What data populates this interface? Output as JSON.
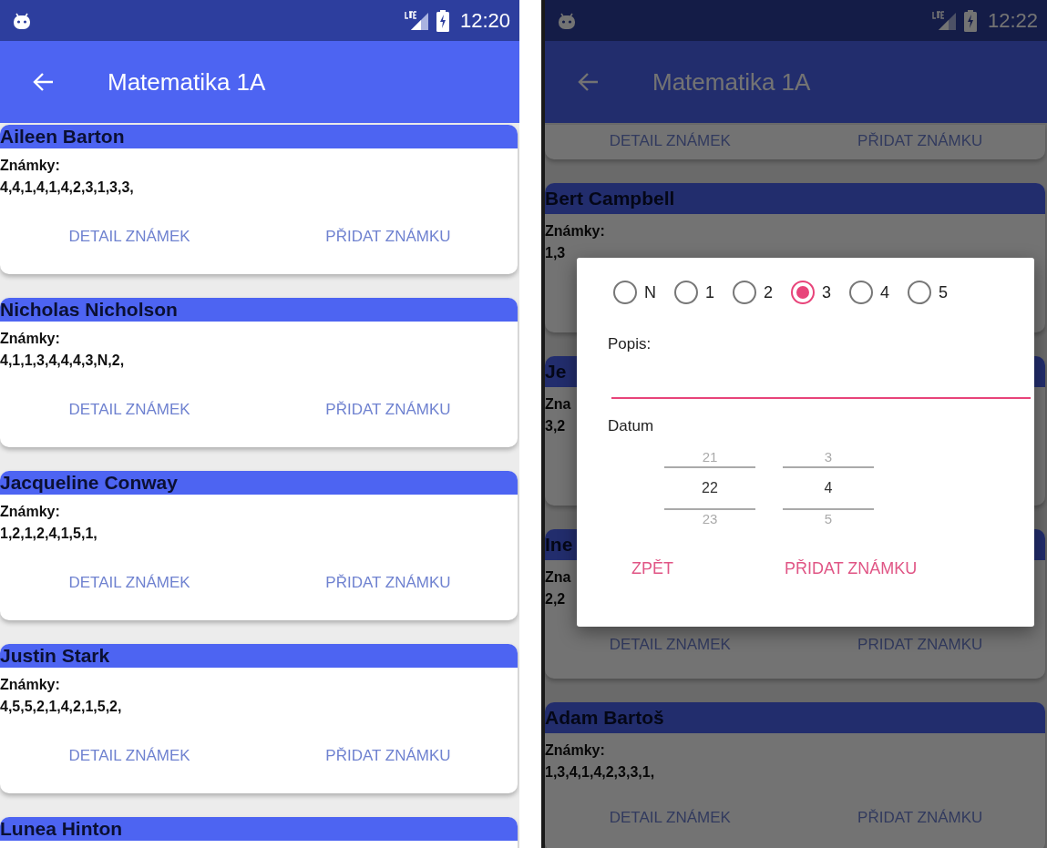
{
  "screens": [
    {
      "dimmed": false,
      "status_bar": {
        "time": "12:20"
      },
      "toolbar": {
        "title": "Matematika 1A"
      },
      "students": [
        {
          "kind": "full",
          "name": "Aileen Barton",
          "grades_label": "Známky:",
          "grades": "4,4,1,4,1,4,2,3,1,3,3,",
          "buttons": [
            "DETAIL ZNÁMEK",
            "PŘIDAT ZNÁMKU"
          ]
        },
        {
          "kind": "full",
          "name": "Nicholas Nicholson",
          "grades_label": "Známky:",
          "grades": "4,1,1,3,4,4,4,3,N,2,",
          "buttons": [
            "DETAIL ZNÁMEK",
            "PŘIDAT ZNÁMKU"
          ]
        },
        {
          "kind": "full",
          "name": "Jacqueline Conway",
          "grades_label": "Známky:",
          "grades": "1,2,1,2,4,1,5,1,",
          "buttons": [
            "DETAIL ZNÁMEK",
            "PŘIDAT ZNÁMKU"
          ]
        },
        {
          "kind": "full",
          "name": "Justin Stark",
          "grades_label": "Známky:",
          "grades": "4,5,5,2,1,4,2,1,5,2,",
          "buttons": [
            "DETAIL ZNÁMEK",
            "PŘIDAT ZNÁMKU"
          ]
        },
        {
          "kind": "full",
          "name": "Lunea Hinton"
        }
      ]
    },
    {
      "dimmed": true,
      "status_bar": {
        "time": "12:22"
      },
      "toolbar": {
        "title": "Matematika 1A"
      },
      "students": [
        {
          "kind": "partial",
          "buttons": [
            "DETAIL ZNÁMEK",
            "PŘIDAT ZNÁMKU"
          ]
        },
        {
          "kind": "full",
          "name": "Bert Campbell",
          "grades_label": "Známky:",
          "grades": "1,3"
        },
        {
          "kind": "full",
          "name": "Je",
          "grades_label": "Zna",
          "grades": "3,2"
        },
        {
          "kind": "full",
          "name": "Ine",
          "grades_label": "Zna",
          "grades": "2,2",
          "buttons": [
            "DETAIL ZNAMEK",
            "PRIDAT ZNAMKU"
          ]
        },
        {
          "kind": "full",
          "name": "Adam Bartoš",
          "grades_label": "Známky:",
          "grades": "1,3,4,1,4,2,3,3,1,",
          "buttons": [
            "DETAIL ZNÁMEK",
            "PŘIDAT ZNÁMKU"
          ]
        }
      ],
      "dialog": {
        "grades": [
          {
            "label": "N",
            "selected": false
          },
          {
            "label": "1",
            "selected": false
          },
          {
            "label": "2",
            "selected": false
          },
          {
            "label": "3",
            "selected": true
          },
          {
            "label": "4",
            "selected": false
          },
          {
            "label": "5",
            "selected": false
          }
        ],
        "description_label": "Popis:",
        "date_label": "Datum",
        "pickers": [
          {
            "previous": "21",
            "current": "22",
            "next": "23"
          },
          {
            "previous": "3",
            "current": "4",
            "next": "5"
          }
        ],
        "buttons": [
          "ZPĚT",
          "PŘIDAT ZNÁMKU"
        ]
      }
    }
  ]
}
